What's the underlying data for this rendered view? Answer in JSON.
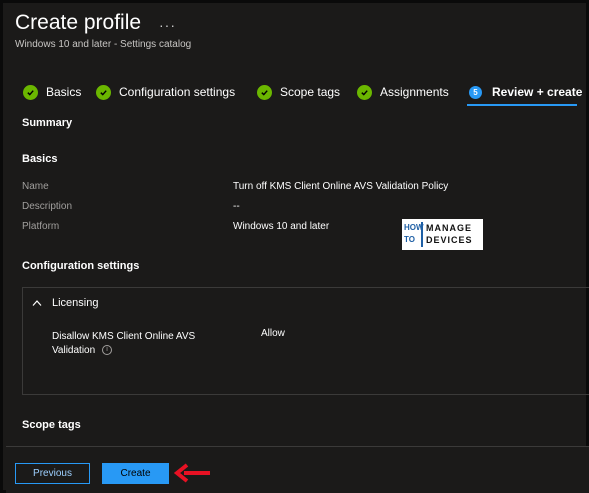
{
  "header": {
    "title": "Create profile",
    "more": "···",
    "subtitle": "Windows 10 and later - Settings catalog"
  },
  "tabs": [
    {
      "label": "Basics",
      "state": "complete"
    },
    {
      "label": "Configuration settings",
      "state": "complete"
    },
    {
      "label": "Scope tags",
      "state": "complete"
    },
    {
      "label": "Assignments",
      "state": "complete"
    },
    {
      "label": "Review + create",
      "state": "active",
      "step": "5"
    }
  ],
  "summary": {
    "heading": "Summary",
    "basics": {
      "heading": "Basics",
      "rows": [
        {
          "label": "Name",
          "value": "Turn off KMS Client Online AVS Validation Policy"
        },
        {
          "label": "Description",
          "value": "--"
        },
        {
          "label": "Platform",
          "value": "Windows 10 and later"
        }
      ]
    },
    "configuration": {
      "heading": "Configuration settings",
      "group": "Licensing",
      "setting_label_line1": "Disallow KMS Client Online AVS",
      "setting_label_line2": "Validation",
      "setting_value": "Allow"
    },
    "scope_tags": {
      "heading": "Scope tags"
    }
  },
  "logo": {
    "how": "HOW",
    "to": "TO",
    "manage": "MANAGE",
    "devices": "DEVICES"
  },
  "footer": {
    "previous_label": "Previous",
    "create_label": "Create"
  },
  "colors": {
    "accent": "#2899f5",
    "success": "#6bb700",
    "annotation_arrow": "#e81123"
  }
}
